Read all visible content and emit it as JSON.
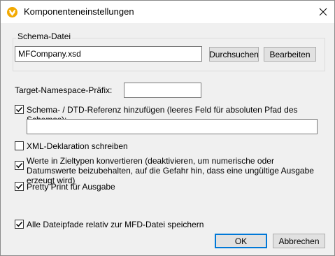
{
  "window": {
    "title": "Komponenteneinstellungen",
    "close_glyph": "✕"
  },
  "schema_group": {
    "legend": "Schema-Datei",
    "file_value": "MFCompany.xsd",
    "browse_label": "Durchsuchen",
    "edit_label": "Bearbeiten"
  },
  "namespace": {
    "label": "Target-Namespace-Präfix:",
    "value": ""
  },
  "options": {
    "add_schema_ref": {
      "label": "Schema- / DTD-Referenz hinzufügen (leeres Feld für absoluten Pfad des Schemas):",
      "checked": true
    },
    "schema_path_value": "",
    "write_xml_decl": {
      "label": "XML-Deklaration schreiben",
      "checked": false
    },
    "convert_types": {
      "label": "Werte in Zieltypen konvertieren (deaktivieren, um numerische oder Datumswerte beizubehalten, auf die Gefahr hin, dass eine ungültige Ausgabe erzeugt wird)",
      "checked": true
    },
    "pretty_print": {
      "label": "Pretty Print für Ausgabe",
      "checked": true
    },
    "relative_paths": {
      "label": "Alle Dateipfade relativ zur MFD-Datei speichern",
      "checked": true
    }
  },
  "footer": {
    "ok_label": "OK",
    "cancel_label": "Abbrechen"
  },
  "colors": {
    "accent": "#0078d7",
    "app_icon": "#f2a900"
  }
}
